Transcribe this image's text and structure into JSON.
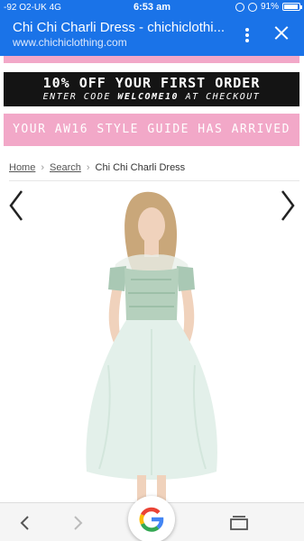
{
  "status_bar": {
    "carrier": "-92 O2-UK  4G",
    "time": "6:53 am",
    "battery_percent": "91%",
    "battery_level": 0.91
  },
  "browser": {
    "page_title": "Chi Chi Charli Dress - chichiclothi...",
    "url": "www.chichiclothing.com",
    "accent_color": "#1a73e8"
  },
  "promo": {
    "line1": "10% OFF YOUR FIRST ORDER",
    "line2_prefix": "ENTER CODE ",
    "code": "WELCOME10",
    "line2_suffix": " AT CHECKOUT"
  },
  "style_guide_banner": "YOUR AW16 STYLE GUIDE HAS ARRIVED",
  "breadcrumb": {
    "items": [
      {
        "label": "Home"
      },
      {
        "label": "Search"
      },
      {
        "label": "Chi Chi Charli Dress"
      }
    ],
    "separator": "›"
  },
  "icons": {
    "prev": "chevron-left-icon",
    "next": "chevron-right-icon",
    "back": "back-arrow-icon",
    "forward": "forward-arrow-icon",
    "google": "google-logo-icon",
    "tabs": "tabs-icon"
  }
}
